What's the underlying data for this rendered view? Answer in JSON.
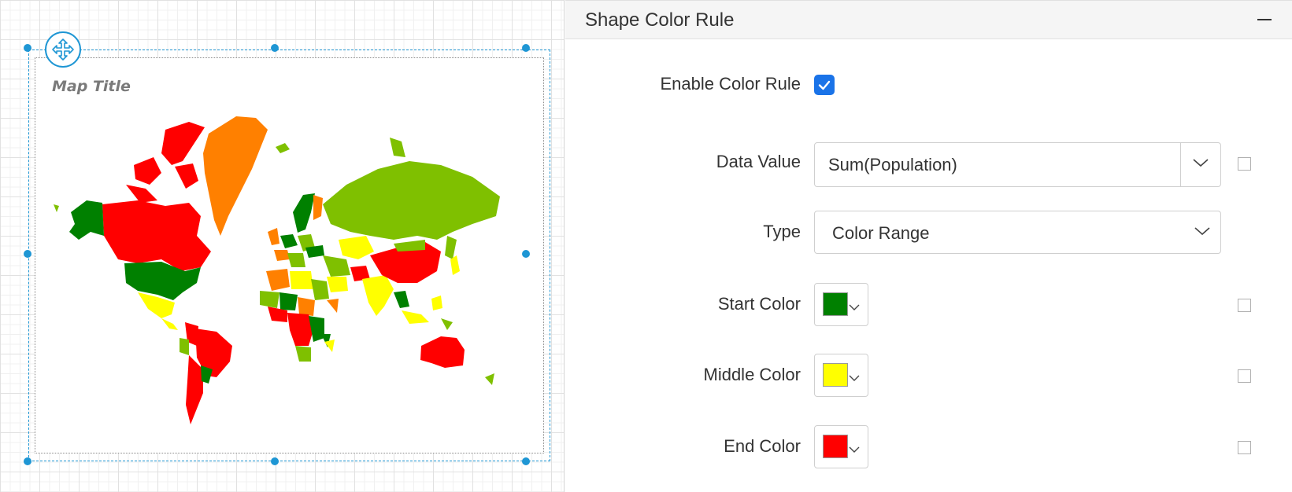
{
  "map": {
    "title": "Map Title",
    "colors": {
      "green": "#008000",
      "yellowgreen": "#7fc000",
      "yellow": "#ffff00",
      "orange": "#ff8000",
      "red": "#ff0000"
    }
  },
  "panel": {
    "title": "Shape Color Rule",
    "enable_color_rule": {
      "label": "Enable Color Rule",
      "checked": true
    },
    "data_value": {
      "label": "Data Value",
      "value": "Sum(Population)"
    },
    "type": {
      "label": "Type",
      "value": "Color Range"
    },
    "start_color": {
      "label": "Start Color",
      "color": "#008000"
    },
    "middle_color": {
      "label": "Middle Color",
      "color": "#ffff00"
    },
    "end_color": {
      "label": "End Color",
      "color": "#ff0000"
    }
  }
}
